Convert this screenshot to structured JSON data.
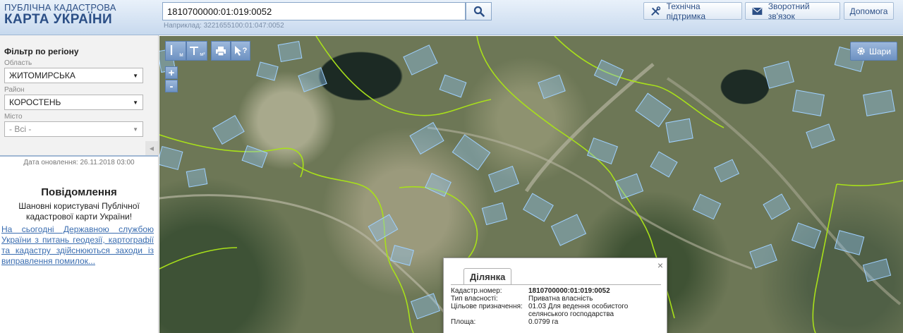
{
  "header": {
    "logo_line1": "ПУБЛІЧНА КАДАСТРОВА",
    "logo_line2": "КАРТА УКРАЇНИ",
    "search_value": "1810700000:01:019:0052",
    "search_hint": "Наприклад: 3221655100:01:047:0052",
    "support_label": "Технічна підтримка",
    "feedback_label": "Зворотний зв'язок",
    "help_label": "Допомога"
  },
  "sidebar": {
    "filter_title": "Фільтр по регіону",
    "region_label": "Область",
    "region_value": "ЖИТОМИРСЬКА",
    "district_label": "Район",
    "district_value": "КОРОСТЕНЬ",
    "city_label": "Місто",
    "city_value": "- Всі -",
    "update_date": "Дата оновлення: 26.11.2018 03:00",
    "notice_title": "Повідомлення",
    "notice_text": "Шановні користувачі Публічної кадастрової карти України!",
    "notice_link": "На сьогодні Державною службою України з питань геодезії, картографії та кадастру здійснюються заходи із виправлення помилок..."
  },
  "map": {
    "layers_label": "Шари",
    "zoom_in": "+",
    "zoom_out": "-",
    "tool_length_sub": "м",
    "tool_area_sub": "м²",
    "tool_info_symbol": "?"
  },
  "popup": {
    "close": "×",
    "tab": "Ділянка",
    "rows": [
      {
        "key": "Кадастр.номер:",
        "value": "1810700000:01:019:0052"
      },
      {
        "key": "Тип власності:",
        "value": "Приватна власність"
      },
      {
        "key": "Цільове призначення:",
        "value": "01.03 Для ведення особистого селянського господарства"
      },
      {
        "key": "Площа:",
        "value": "0.0799 га"
      }
    ]
  },
  "colors": {
    "brand_blue": "#2c4f86",
    "parcel_fill": "#8fc3f0",
    "boundary_green": "#a8e01a"
  }
}
